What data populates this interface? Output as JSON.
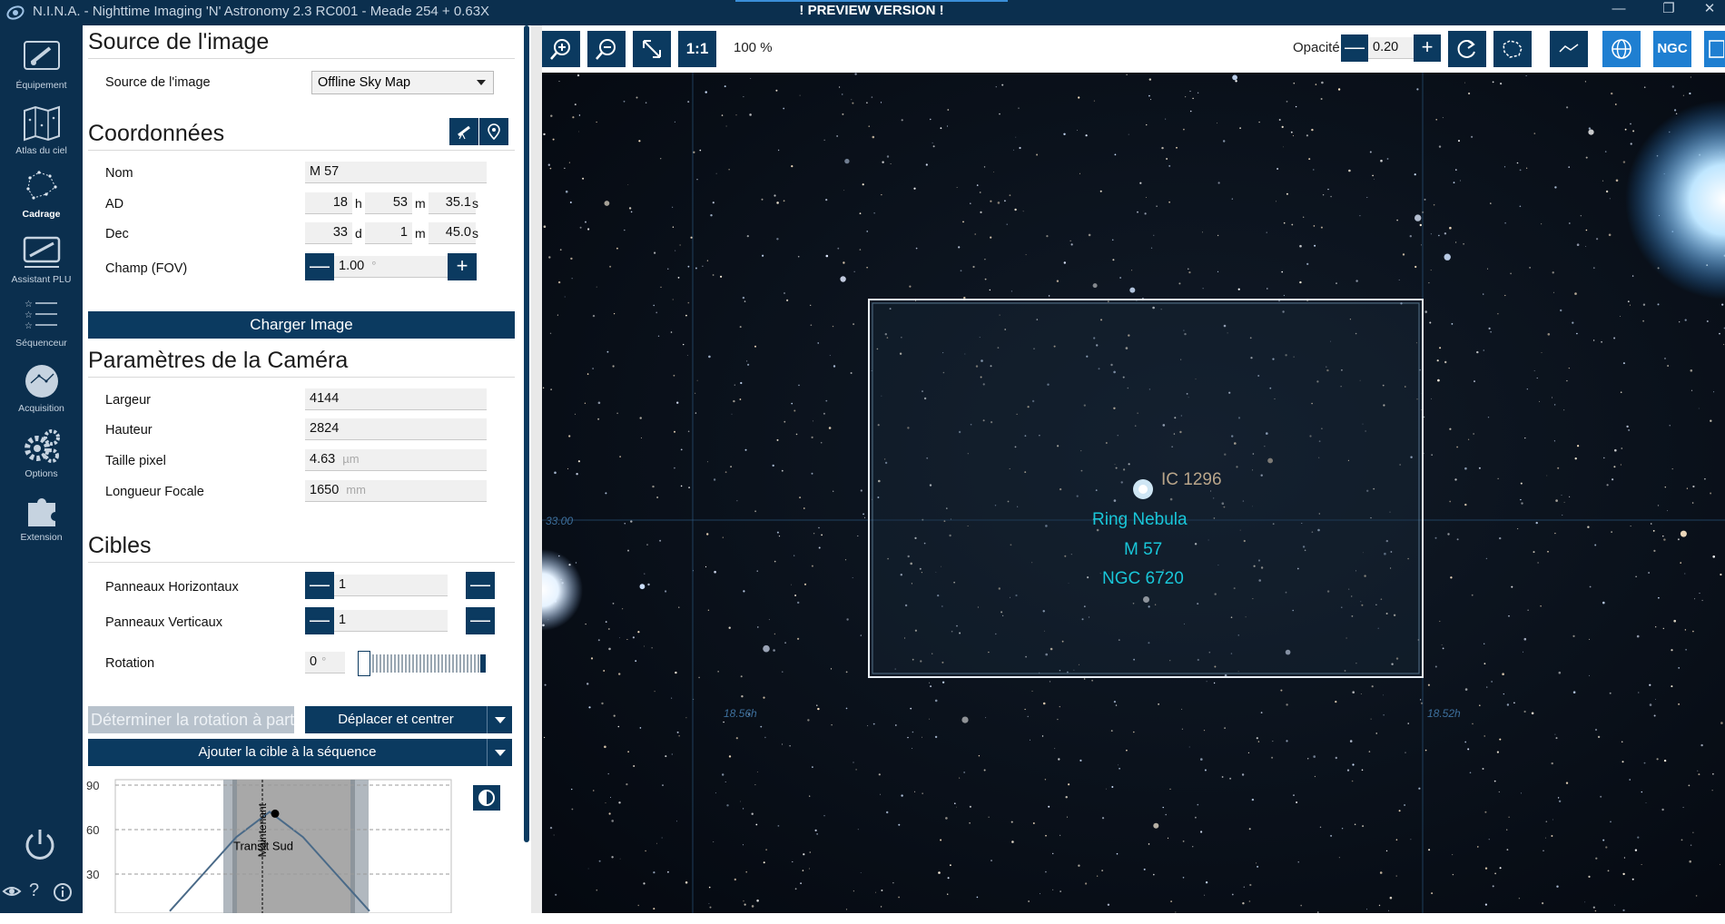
{
  "titlebar": {
    "title": "N.I.N.A. - Nighttime Imaging 'N' Astronomy 2.3 RC001   -  Meade 254 + 0.63X",
    "preview": "! PREVIEW VERSION !",
    "minimize": "—",
    "maximize": "❐",
    "close": "✕"
  },
  "nav": [
    {
      "label": "Équipement",
      "icon": "camera-telescope-icon"
    },
    {
      "label": "Atlas du ciel",
      "icon": "sky-map-icon"
    },
    {
      "label": "Cadrage",
      "icon": "constellation-icon",
      "active": true
    },
    {
      "label": "Assistant PLU",
      "icon": "flat-wizard-icon"
    },
    {
      "label": "Séquenceur",
      "icon": "sequence-stars-icon"
    },
    {
      "label": "Acquisition",
      "icon": "imaging-icon"
    },
    {
      "label": "Options",
      "icon": "gears-icon"
    },
    {
      "label": "Extension",
      "icon": "puzzle-icon"
    }
  ],
  "panel": {
    "source_title": "Source de l'image",
    "source_label": "Source de l'image",
    "source_value": "Offline Sky Map",
    "coords_title": "Coordonnées",
    "name_label": "Nom",
    "name_value": "M 57",
    "ra_label": "AD",
    "ra_h": "18",
    "ra_h_unit": "h",
    "ra_m": "53",
    "ra_m_unit": "m",
    "ra_s": "35.1",
    "ra_s_unit": "s",
    "dec_label": "Dec",
    "dec_d": "33",
    "dec_d_unit": "d",
    "dec_m": "1",
    "dec_m_unit": "m",
    "dec_s": "45.0",
    "dec_s_unit": "s",
    "fov_label": "Champ (FOV)",
    "fov_value": "1.00",
    "fov_unit": "°",
    "load_button": "Charger Image",
    "camera_title": "Paramètres de la Caméra",
    "width_label": "Largeur",
    "width_value": "4144",
    "height_label": "Hauteur",
    "height_value": "2824",
    "pixel_label": "Taille pixel",
    "pixel_value": "4.63",
    "pixel_unit": "µm",
    "focal_label": "Longueur Focale",
    "focal_value": "1650",
    "focal_unit": "mm",
    "targets_title": "Cibles",
    "hpanels_label": "Panneaux Horizontaux",
    "hpanels_value": "1",
    "vpanels_label": "Panneaux Verticaux",
    "vpanels_value": "1",
    "rotation_label": "Rotation",
    "rotation_value": "0",
    "rotation_unit": "°",
    "determine_button": "Déterminer la rotation à partir",
    "slew_button": "Déplacer et centrer",
    "add_button": "Ajouter la cible à la séquence",
    "minus": "—",
    "plus": "+"
  },
  "chart_data": {
    "type": "line",
    "y_ticks": [
      "90",
      "60",
      "30"
    ],
    "ylim": [
      0,
      90
    ],
    "annotations": [
      "Maintenant",
      "Transit Sud"
    ],
    "series": [
      {
        "x": [
          0,
          1,
          2,
          3,
          4,
          5,
          6
        ],
        "values": [
          5,
          30,
          55,
          72,
          55,
          30,
          5
        ]
      }
    ]
  },
  "toolbar": {
    "zoom": "100 %",
    "one_to_one": "1:1",
    "opacity_label": "Opacité",
    "opacity_value": "0.20",
    "ngc": "NGC"
  },
  "sky": {
    "label_ic": "IC 1296",
    "label_ring": "Ring Nebula",
    "label_m57": "M 57",
    "label_ngc": "NGC 6720",
    "grid_dec": "33.00",
    "grid_ra1": "18.56h",
    "grid_ra2": "18.52h"
  },
  "colors": {
    "navy": "#0b2f4e",
    "button": "#0b3a60",
    "accent": "#1f7fd1",
    "label_cyan": "#19c6d8",
    "label_tan": "#b9a58a"
  }
}
